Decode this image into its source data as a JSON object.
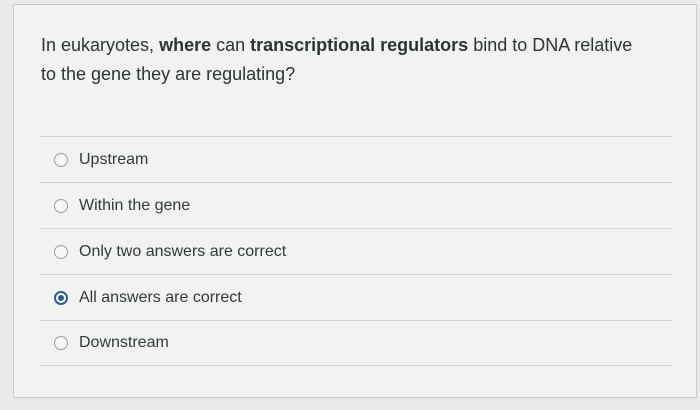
{
  "question": {
    "parts": [
      {
        "text": "In eukaryotes, ",
        "bold": false
      },
      {
        "text": "where",
        "bold": true
      },
      {
        "text": " can ",
        "bold": false
      },
      {
        "text": "transcriptional regulators",
        "bold": true
      },
      {
        "text": " bind to DNA relative",
        "bold": false
      },
      {
        "text": "to the gene they are regulating?",
        "bold": false
      }
    ]
  },
  "answers": [
    {
      "label": "Upstream",
      "selected": false
    },
    {
      "label": "Within the gene",
      "selected": false
    },
    {
      "label": "Only two answers are correct",
      "selected": false
    },
    {
      "label": "All answers are correct",
      "selected": true
    },
    {
      "label": "Downstream",
      "selected": false
    }
  ],
  "colors": {
    "accent": "#2b5d9a",
    "text": "#2f3337",
    "background": "#f1f3f1"
  }
}
